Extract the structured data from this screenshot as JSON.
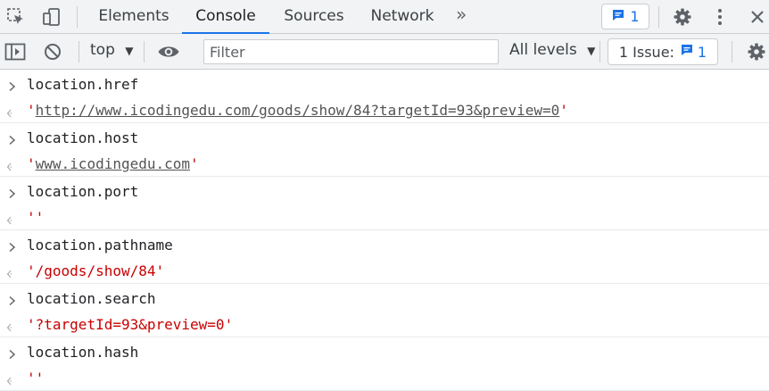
{
  "tabs": [
    {
      "label": "Elements",
      "active": false
    },
    {
      "label": "Console",
      "active": true
    },
    {
      "label": "Sources",
      "active": false
    },
    {
      "label": "Network",
      "active": false
    }
  ],
  "more_tabs": "»",
  "messages_badge": {
    "count": "1"
  },
  "toolbar": {
    "context": "top",
    "filter_placeholder": "Filter",
    "levels": "All levels",
    "issues_label": "1 Issue:",
    "issues_count": "1"
  },
  "console": {
    "entries": [
      {
        "input": "location.href",
        "output_text": "http://www.icodingedu.com/goods/show/84?targetId=93&preview=0",
        "is_link": true
      },
      {
        "input": "location.host",
        "output_text": "www.icodingedu.com",
        "is_link": true
      },
      {
        "input": "location.port",
        "output_text": "",
        "is_link": false
      },
      {
        "input": "location.pathname",
        "output_text": "/goods/show/84",
        "is_link": false
      },
      {
        "input": "location.search",
        "output_text": "?targetId=93&preview=0",
        "is_link": false
      },
      {
        "input": "location.hash",
        "output_text": "",
        "is_link": false
      }
    ]
  },
  "colors": {
    "accent": "#1a73e8",
    "string": "#c80000",
    "link": "#545454",
    "toolbar_bg": "#f1f3f4"
  }
}
